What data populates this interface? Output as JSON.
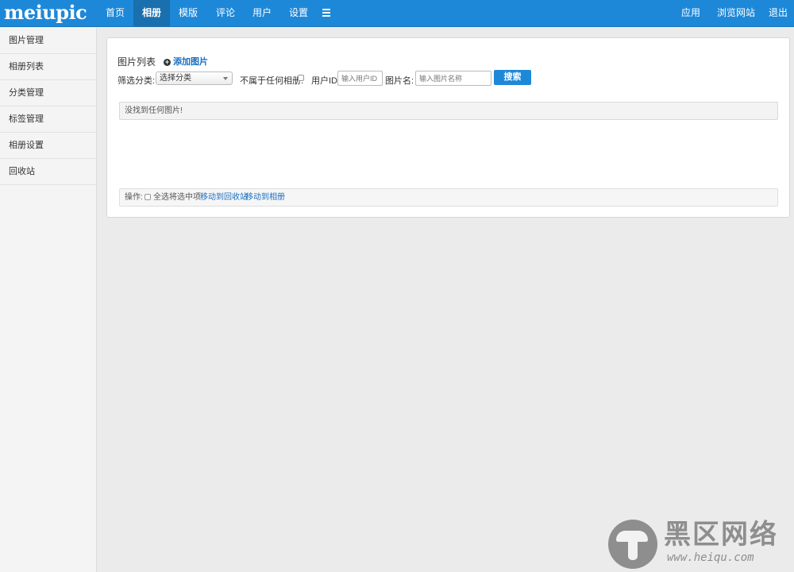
{
  "header": {
    "logo": "meiupic",
    "nav": [
      {
        "label": "首页",
        "active": false
      },
      {
        "label": "相册",
        "active": true
      },
      {
        "label": "模版",
        "active": false
      },
      {
        "label": "评论",
        "active": false
      },
      {
        "label": "用户",
        "active": false
      },
      {
        "label": "设置",
        "active": false
      }
    ],
    "right": [
      "应用",
      "浏览网站",
      "退出"
    ]
  },
  "sidebar": {
    "items": [
      {
        "label": "图片管理"
      },
      {
        "label": "相册列表"
      },
      {
        "label": "分类管理"
      },
      {
        "label": "标签管理"
      },
      {
        "label": "相册设置"
      },
      {
        "label": "回收站"
      }
    ]
  },
  "main": {
    "title": "图片列表",
    "add_label": "添加图片",
    "filter": {
      "category_label": "筛选分类:",
      "category_value": "选择分类",
      "no_album_label": "不属于任何相册:",
      "user_id_label": "用户ID:",
      "user_id_placeholder": "输入用户ID",
      "name_label": "图片名:",
      "name_placeholder": "输入图片名称",
      "search_label": "搜索"
    },
    "empty_notice": "没找到任何图片!",
    "ops": {
      "label": "操作:",
      "select_all": "全选",
      "selected_text": "将选中项",
      "move_recycle": "移动到回收站",
      "move_album": "移动到相册"
    }
  },
  "watermark": {
    "text": "黑区网络",
    "url": "www.heiqu.com"
  },
  "colors": {
    "brand": "#1e88d8",
    "nav_active": "#1a6fae",
    "link": "#1a6fc0",
    "background": "#ebebeb"
  }
}
